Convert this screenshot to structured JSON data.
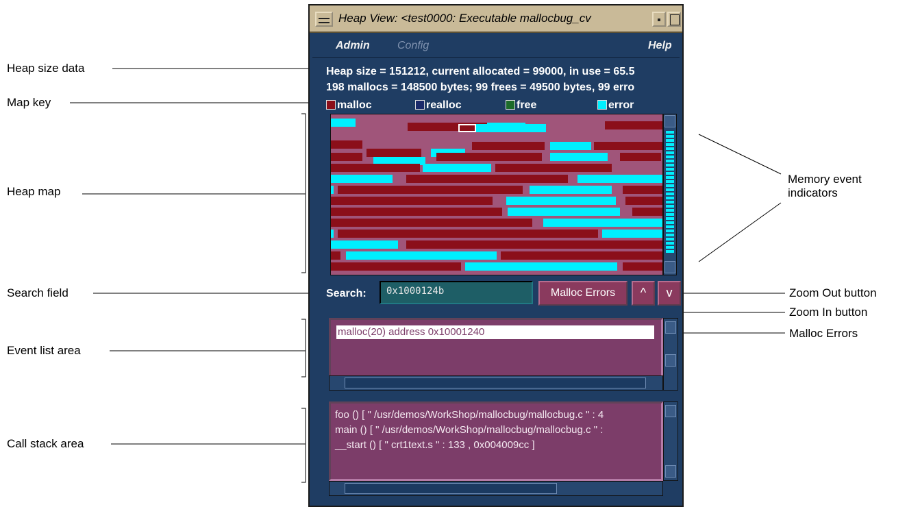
{
  "window": {
    "title": "Heap View: <test0000: Executable mallocbug_cv"
  },
  "menubar": {
    "admin": "Admin",
    "config": "Config",
    "help": "Help"
  },
  "heap_info": {
    "line1": "Heap size = 151212, current allocated = 99000, in use = 65.5",
    "line2": "198 mallocs = 148500 bytes; 99 frees = 49500 bytes, 99 erro"
  },
  "map_key": {
    "malloc": "malloc",
    "realloc": "realloc",
    "free": "free",
    "error": "error",
    "colors": {
      "malloc": "#8b0f1a",
      "realloc": "#1a2a6a",
      "free": "#1d6b2a",
      "error": "#00f0ff"
    }
  },
  "search": {
    "label": "Search:",
    "value": "0x1000124b"
  },
  "buttons": {
    "malloc_errors": "Malloc Errors",
    "zoom_in": "^",
    "zoom_out": "v"
  },
  "event_list": {
    "selected": "malloc(20) address 0x10001240"
  },
  "call_stack": {
    "lines": [
      "foo () [ \" /usr/demos/WorkShop/mallocbug/mallocbug.c \" : 4",
      "main () [ \" /usr/demos/WorkShop/mallocbug/mallocbug.c \" :",
      "__start () [ \" crt1text.s \" : 133 , 0x004009cc ]"
    ]
  },
  "callouts": {
    "heap_size_data": "Heap size data",
    "map_key": "Map key",
    "heap_map": "Heap map",
    "search_field": "Search field",
    "event_list_area": "Event list area",
    "call_stack_area": "Call stack area",
    "memory_event_indicators": "Memory event indicators",
    "zoom_out_button": "Zoom Out button",
    "zoom_in_button": "Zoom In button",
    "malloc_errors": "Malloc Errors"
  }
}
